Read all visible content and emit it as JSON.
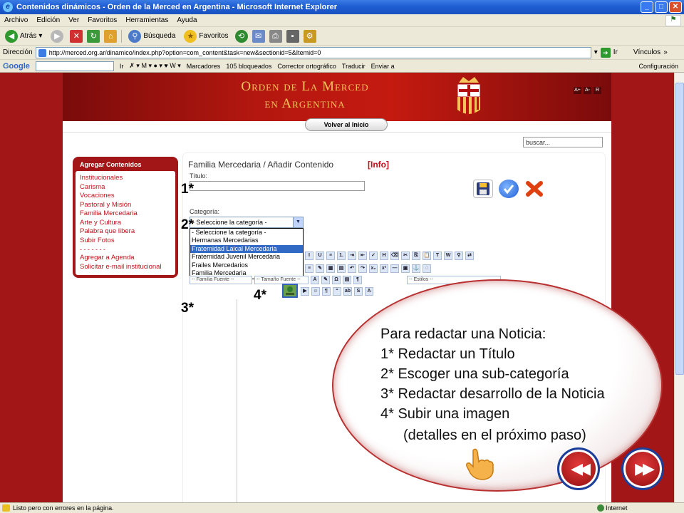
{
  "window": {
    "title": "Contenidos dinámicos - Orden de la Merced en Argentina - Microsoft Internet Explorer"
  },
  "menu": [
    "Archivo",
    "Edición",
    "Ver",
    "Favoritos",
    "Herramientas",
    "Ayuda"
  ],
  "toolbar": {
    "back": "Atrás",
    "search": "Búsqueda",
    "favorites": "Favoritos"
  },
  "address": {
    "label": "Dirección",
    "url": "http://merced.org.ar/dinamico/index.php?option=com_content&task=new&sectionid=5&Itemid=0",
    "go": "Ir",
    "links": "Vínculos"
  },
  "googlebar": {
    "logo": "Google",
    "go": "Ir",
    "bookmarks": "Marcadores",
    "blocked": "105 bloqueados",
    "spell": "Corrector ortográfico",
    "translate": "Traducir",
    "send": "Enviar a",
    "settings": "Configuración"
  },
  "site": {
    "title_line1": "Orden de La Merced",
    "title_line2": "en Argentina",
    "font_buttons": [
      "A+",
      "A-",
      "R"
    ],
    "back_home": "Volver al Inicio",
    "search_placeholder": "buscar..."
  },
  "sidebar": {
    "title": "Agregar Contenidos",
    "items": [
      "Institucionales",
      "Carisma",
      "Vocaciones",
      "Pastoral y Misión",
      "Familia Mercedaria",
      "Arte y Cultura",
      "Palabra que libera",
      "Subir Fotos"
    ],
    "separator": "- - - - - - -",
    "extra_items": [
      "Agregar a Agenda",
      "Solicitar e-mail institucional"
    ]
  },
  "form": {
    "heading": "Familia Mercedaria / Añadir  Contenido",
    "info": "[Info]",
    "title_label": "Título:",
    "category_label": "Categoría:",
    "category_selected": "- Seleccione la categoría -",
    "category_options": [
      "- Seleccione la categoría -",
      "Hermanas Mercedarias",
      "Fraternidad Laical Mercedaria",
      "Fraternidad Juvenil Mercedaria",
      "Frailes Mercedarios",
      "Familia Mercedaria"
    ],
    "highlighted_option_index": 2,
    "editor": {
      "font_family": "-- Familia Fuente --",
      "font_size": "-- Tamaño Fuente --",
      "styles": "-- Estilos --"
    }
  },
  "markers": [
    "1*",
    "2*",
    "3*",
    "4*"
  ],
  "callout": {
    "lines": [
      "Para redactar una Noticia:",
      "1* Redactar un Título",
      "2* Escoger una sub-categoría",
      "3* Redactar desarrollo de la Noticia",
      "4* Subir una imagen",
      "(detalles en el próximo paso)"
    ]
  },
  "nav": {
    "prev": "◀◀",
    "next": "▶▶"
  },
  "status": {
    "text": "Listo pero con errores en la página.",
    "zone": "Internet"
  },
  "colors": {
    "brand_red": "#a21617",
    "link_red": "#c0101a",
    "highlight": "#316ac5"
  }
}
